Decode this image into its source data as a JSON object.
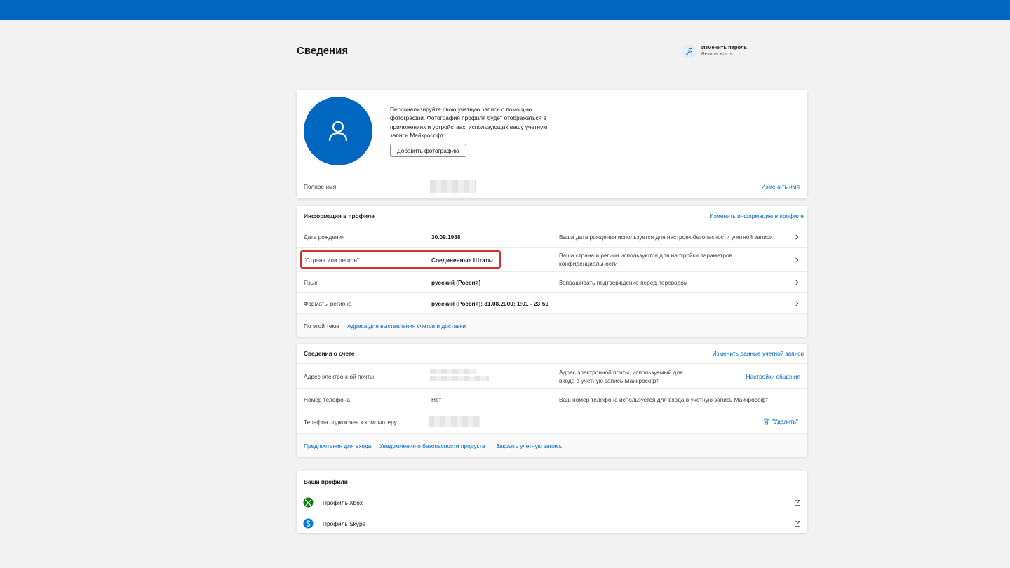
{
  "page": {
    "title": "Сведения"
  },
  "quick_link": {
    "title": "Изменить пароль",
    "subtitle": "Безопасность"
  },
  "photo": {
    "description": "Персонализируйте свою учетную запись с помощью фотографии. Фотография профиля будет отображаться в приложениях и устройствах, использующих вашу учетную запись Майкрософт.",
    "button": "Добавить фотографию"
  },
  "full_name": {
    "label": "Полное имя",
    "action": "Изменить имя"
  },
  "profile_info": {
    "header": "Информация в профиле",
    "action": "Изменить информацию в профиле",
    "rows": [
      {
        "label": "Дата рождения",
        "value": "30.09.1988",
        "desc": "Ваша дата рождения используется для настроек безопасности учетной записи"
      },
      {
        "label": "\"Страна или регион\"",
        "value": "Соединенные Штаты",
        "desc": "Ваша страна и регион используются для настройки параметров конфиденциальности"
      },
      {
        "label": "Язык",
        "value": "русский (Россия)",
        "desc": "Запрашивать подтверждение перед переводом"
      },
      {
        "label": "Форматы региона",
        "value": "русский (Россия); 31.08.2000; 1:01 - 23:59",
        "desc": ""
      }
    ],
    "footer_label": "По этой теме",
    "footer_link": "Адреса для выставления счетов и доставки"
  },
  "account_info": {
    "header": "Сведения о счете",
    "action": "Изменить данные учетной записи",
    "email_label": "Адрес электронной почты",
    "email_desc": "Адрес электронной почты, используемый для входа в учетную запись Майкрософт",
    "email_action": "Настройки общения",
    "phone_label": "Номер телефона",
    "phone_value": "Нет",
    "phone_desc": "Ваш номер телефона используется для входа в учетную запись Майкрософт",
    "linked_label": "Телефон подключен к компьютеру",
    "linked_action": "\"Удалить\"",
    "footer_links": [
      "Предпочтения для входа",
      "Уведомления о безопасности продукта",
      "Закрыть учетную запись"
    ]
  },
  "profiles": {
    "header": "Ваши профили",
    "items": [
      {
        "label": "Профиль Xbox",
        "icon": "xbox-icon"
      },
      {
        "label": "Профиль Skype",
        "icon": "skype-icon"
      }
    ]
  },
  "colors": {
    "accent": "#0067c0",
    "highlight": "#d43030",
    "xbox": "#107c10",
    "skype": "#0078d4"
  }
}
